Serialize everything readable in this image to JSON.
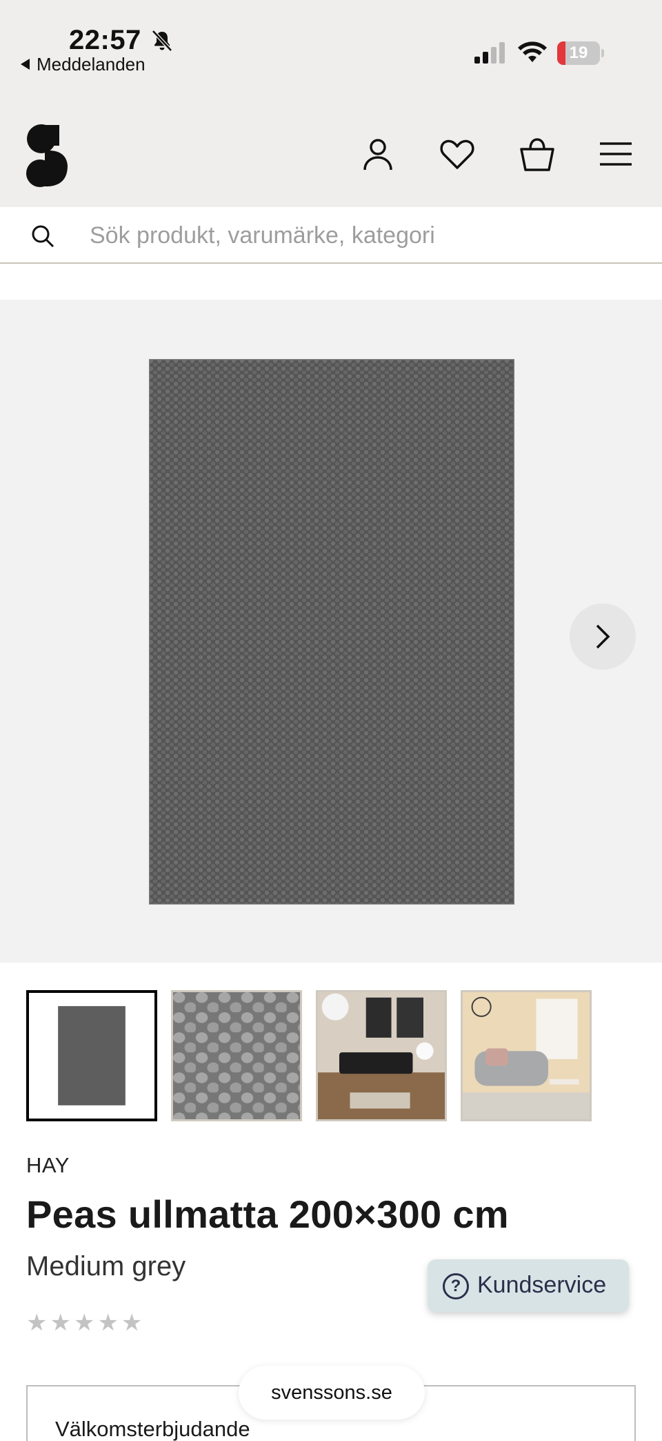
{
  "status_bar": {
    "time": "22:57",
    "back_label": "Meddelanden",
    "battery_level": "19",
    "battery_fraction": 0.19,
    "battery_color": "#e2373d"
  },
  "header": {
    "logo_icon": "svenssons-s-logo",
    "icons": [
      "user-icon",
      "heart-icon",
      "shopping-bag-icon",
      "menu-icon"
    ]
  },
  "search": {
    "placeholder": "Sök produkt, varumärke, kategori"
  },
  "gallery": {
    "image_count": 4,
    "selected_index": 0,
    "next_icon": "chevron-right-icon"
  },
  "product": {
    "brand": "HAY",
    "title": "Peas ullmatta 200×300 cm",
    "variant": "Medium grey",
    "rating_stars": "★★★★★",
    "rating_value": 0
  },
  "support": {
    "label": "Kundservice",
    "icon": "?"
  },
  "offer": {
    "title": "Välkomsterbjudande"
  },
  "browser": {
    "url": "svenssons.se"
  }
}
